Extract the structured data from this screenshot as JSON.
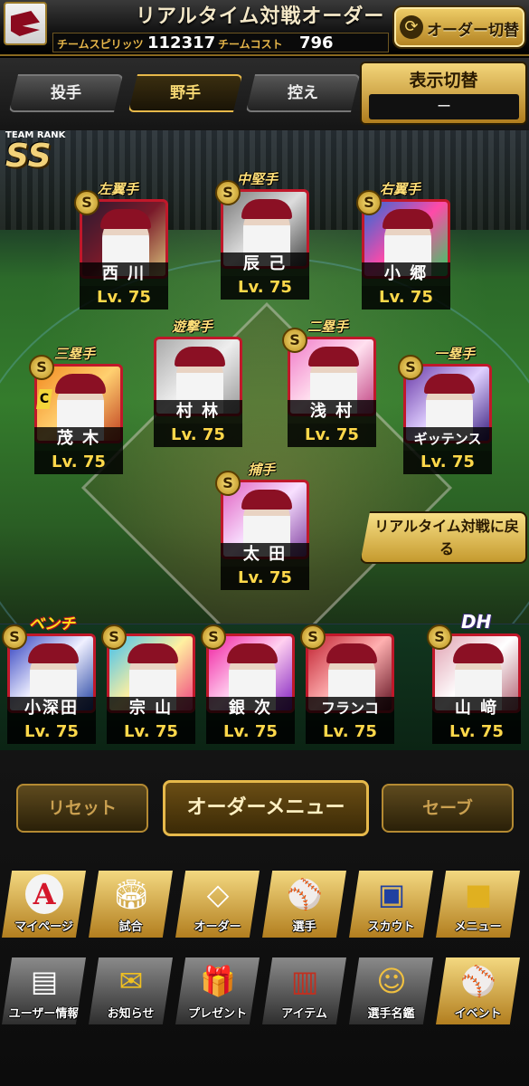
{
  "header": {
    "title": "リアルタイム対戦オーダー",
    "spirit_label": "チームスピリッツ",
    "spirit_value": "112317",
    "cost_label": "チームコスト",
    "cost_value": "796",
    "order_switch_label": "オーダー切替"
  },
  "tabs": [
    {
      "label": "投手",
      "active": false
    },
    {
      "label": "野手",
      "active": true
    },
    {
      "label": "控え",
      "active": false
    }
  ],
  "display_switch": {
    "label": "表示切替",
    "value": "ー"
  },
  "team_rank": {
    "title": "TEAM RANK",
    "rank": "SS"
  },
  "positions": {
    "lf": "左翼手",
    "cf": "中堅手",
    "rf": "右翼手",
    "ss": "遊撃手",
    "b2": "二塁手",
    "b3": "三塁手",
    "b1": "一塁手",
    "c": "捕手",
    "bench": "ベンチ",
    "dh": "DH"
  },
  "players": {
    "lf": {
      "name": "西 川",
      "level": "Lv. 75",
      "badge": "S"
    },
    "cf": {
      "name": "辰 己",
      "level": "Lv. 75",
      "badge": "S"
    },
    "rf": {
      "name": "小 郷",
      "level": "Lv. 75",
      "badge": "S"
    },
    "ss": {
      "name": "村 林",
      "level": "Lv. 75"
    },
    "b2": {
      "name": "浅 村",
      "level": "Lv. 75",
      "badge": "S"
    },
    "b3": {
      "name": "茂 木",
      "level": "Lv. 75",
      "badge": "S",
      "captain": "C"
    },
    "b1": {
      "name": "ギッテンス",
      "level": "Lv. 75",
      "badge": "S"
    },
    "c": {
      "name": "太 田",
      "level": "Lv. 75",
      "badge": "S"
    },
    "bench1": {
      "name": "小深田",
      "level": "Lv. 75",
      "badge": "S"
    },
    "bench2": {
      "name": "宗 山",
      "level": "Lv. 75",
      "badge": "S"
    },
    "bench3": {
      "name": "銀 次",
      "level": "Lv. 75",
      "badge": "S"
    },
    "bench4": {
      "name": "フランコ",
      "level": "Lv. 75",
      "badge": "S"
    },
    "dh": {
      "name": "山 﨑",
      "level": "Lv. 75",
      "badge": "S"
    }
  },
  "back_button": "リアルタイム対戦に戻る",
  "actions": {
    "reset": "リセット",
    "order_menu": "オーダーメニュー",
    "save": "セーブ"
  },
  "nav_top": [
    {
      "label": "マイページ",
      "icon": "a-emblem-icon"
    },
    {
      "label": "試合",
      "icon": "stadium-icon"
    },
    {
      "label": "オーダー",
      "icon": "field-order-icon"
    },
    {
      "label": "選手",
      "icon": "player-icon"
    },
    {
      "label": "スカウト",
      "icon": "scout-icon"
    },
    {
      "label": "メニュー",
      "icon": "menu-icon"
    }
  ],
  "nav_bottom": [
    {
      "label": "ユーザー情報",
      "icon": "user-info-icon"
    },
    {
      "label": "お知らせ",
      "icon": "notice-icon"
    },
    {
      "label": "プレゼント",
      "icon": "gift-icon"
    },
    {
      "label": "アイテム",
      "icon": "item-icon"
    },
    {
      "label": "選手名鑑",
      "icon": "player-directory-icon"
    },
    {
      "label": "イベント",
      "icon": "event-icon"
    }
  ],
  "colors": {
    "accent_gold": "#e6b84a",
    "team_red": "#8b1024",
    "level_yellow": "#ffd84a"
  }
}
